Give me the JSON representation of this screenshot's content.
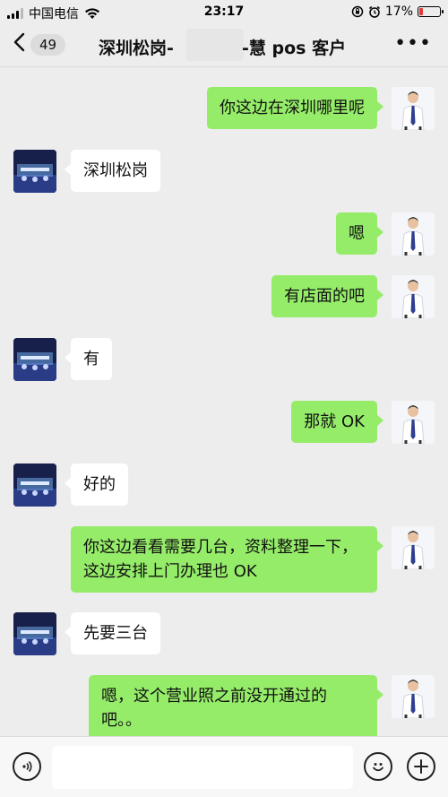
{
  "status": {
    "carrier": "中国电信",
    "time": "23:17",
    "battery_text": "17%",
    "battery_level": 0.17
  },
  "header": {
    "unread_count": "49",
    "title_prefix": "深圳松岗-",
    "title_suffix": "-慧 pos 客户",
    "more_label": "•••"
  },
  "messages": [
    {
      "side": "self",
      "text": "你这边在深圳哪里呢"
    },
    {
      "side": "other",
      "text": "深圳松岗"
    },
    {
      "side": "self",
      "text": "嗯"
    },
    {
      "side": "self",
      "text": "有店面的吧"
    },
    {
      "side": "other",
      "text": "有"
    },
    {
      "side": "self",
      "text": "那就 OK"
    },
    {
      "side": "other",
      "text": "好的"
    },
    {
      "side": "self",
      "text": "你这边看看需要几台，资料整理一下，这边安排上门办理也 OK"
    },
    {
      "side": "other",
      "text": "先要三台"
    },
    {
      "side": "self",
      "text": "嗯，这个营业照之前没开通过的吧。。"
    }
  ],
  "input": {
    "placeholder": ""
  },
  "colors": {
    "self_bubble": "#95ec69",
    "other_bubble": "#ffffff",
    "background": "#ededed"
  }
}
